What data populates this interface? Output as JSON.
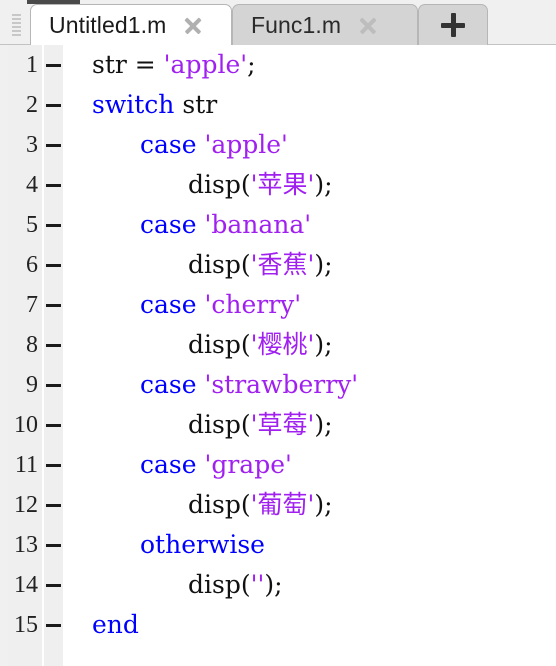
{
  "window": {
    "app": "MATLAB Editor",
    "active_file": "Untitled1.m"
  },
  "tabs": [
    {
      "label": "Untitled1.m",
      "active": true,
      "close_icon": "close-icon"
    },
    {
      "label": "Func1.m",
      "active": false,
      "close_icon": "close-icon"
    }
  ],
  "new_tab_button": {
    "icon": "plus-icon",
    "label": "+"
  },
  "colors": {
    "keyword": "#0000ff",
    "string": "#a020f0",
    "plain": "#111111",
    "gutter_bg": "#efefef",
    "active_tab_bg": "#ffffff",
    "inactive_tab_bg": "#d4d4d4",
    "editor_bg": "#ffffff"
  },
  "editor": {
    "first_line": 1,
    "last_line": 15,
    "line_numbers": [
      1,
      2,
      3,
      4,
      5,
      6,
      7,
      8,
      9,
      10,
      11,
      12,
      13,
      14,
      15
    ],
    "lines": [
      {
        "number": 1,
        "indent": 1,
        "tokens": [
          {
            "t": "str = ",
            "c": "pl"
          },
          {
            "t": "'apple'",
            "c": "str"
          },
          {
            "t": ";",
            "c": "pl"
          }
        ]
      },
      {
        "number": 2,
        "indent": 1,
        "tokens": [
          {
            "t": "switch",
            "c": "kw"
          },
          {
            "t": " str",
            "c": "pl"
          }
        ]
      },
      {
        "number": 3,
        "indent": 2,
        "tokens": [
          {
            "t": "case",
            "c": "kw"
          },
          {
            "t": " ",
            "c": "pl"
          },
          {
            "t": "'apple'",
            "c": "str"
          }
        ]
      },
      {
        "number": 4,
        "indent": 3,
        "tokens": [
          {
            "t": "disp(",
            "c": "pl"
          },
          {
            "t": "'苹果'",
            "c": "str"
          },
          {
            "t": ");",
            "c": "pl"
          }
        ]
      },
      {
        "number": 5,
        "indent": 2,
        "tokens": [
          {
            "t": "case",
            "c": "kw"
          },
          {
            "t": " ",
            "c": "pl"
          },
          {
            "t": "'banana'",
            "c": "str"
          }
        ]
      },
      {
        "number": 6,
        "indent": 3,
        "tokens": [
          {
            "t": "disp(",
            "c": "pl"
          },
          {
            "t": "'香蕉'",
            "c": "str"
          },
          {
            "t": ");",
            "c": "pl"
          }
        ]
      },
      {
        "number": 7,
        "indent": 2,
        "tokens": [
          {
            "t": "case",
            "c": "kw"
          },
          {
            "t": " ",
            "c": "pl"
          },
          {
            "t": "'cherry'",
            "c": "str"
          }
        ]
      },
      {
        "number": 8,
        "indent": 3,
        "tokens": [
          {
            "t": "disp(",
            "c": "pl"
          },
          {
            "t": "'樱桃'",
            "c": "str"
          },
          {
            "t": ");",
            "c": "pl"
          }
        ]
      },
      {
        "number": 9,
        "indent": 2,
        "tokens": [
          {
            "t": "case",
            "c": "kw"
          },
          {
            "t": " ",
            "c": "pl"
          },
          {
            "t": "'strawberry'",
            "c": "str"
          }
        ]
      },
      {
        "number": 10,
        "indent": 3,
        "tokens": [
          {
            "t": "disp(",
            "c": "pl"
          },
          {
            "t": "'草莓'",
            "c": "str"
          },
          {
            "t": ");",
            "c": "pl"
          }
        ]
      },
      {
        "number": 11,
        "indent": 2,
        "tokens": [
          {
            "t": "case",
            "c": "kw"
          },
          {
            "t": " ",
            "c": "pl"
          },
          {
            "t": "'grape'",
            "c": "str"
          }
        ]
      },
      {
        "number": 12,
        "indent": 3,
        "tokens": [
          {
            "t": "disp(",
            "c": "pl"
          },
          {
            "t": "'葡萄'",
            "c": "str"
          },
          {
            "t": ");",
            "c": "pl"
          }
        ]
      },
      {
        "number": 13,
        "indent": 2,
        "tokens": [
          {
            "t": "otherwise",
            "c": "kw"
          }
        ]
      },
      {
        "number": 14,
        "indent": 3,
        "tokens": [
          {
            "t": "disp(",
            "c": "pl"
          },
          {
            "t": "''",
            "c": "str"
          },
          {
            "t": ");",
            "c": "pl"
          }
        ]
      },
      {
        "number": 15,
        "indent": 1,
        "tokens": [
          {
            "t": "end",
            "c": "kw"
          }
        ]
      }
    ]
  }
}
